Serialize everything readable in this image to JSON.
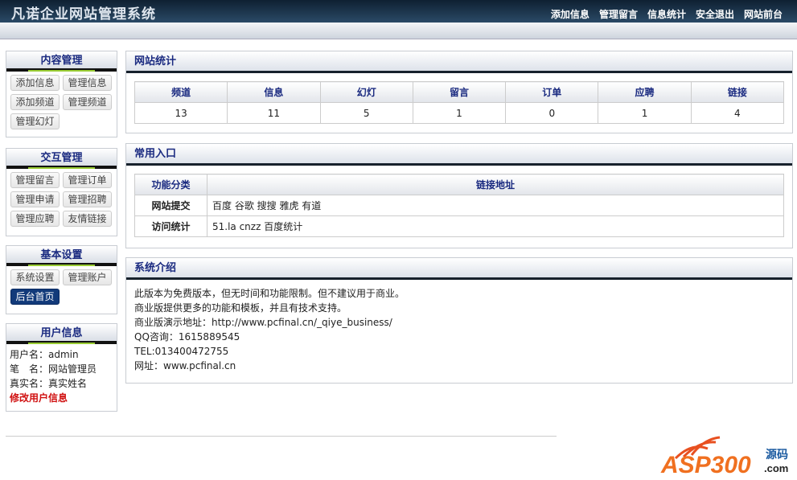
{
  "header": {
    "title": "凡诺企业网站管理系统",
    "nav": [
      "添加信息",
      "管理留言",
      "信息统计",
      "安全退出",
      "网站前台"
    ]
  },
  "sidebar": {
    "content": {
      "title": "内容管理",
      "buttons": [
        "添加信息",
        "管理信息",
        "添加频道",
        "管理频道",
        "管理幻灯"
      ]
    },
    "interact": {
      "title": "交互管理",
      "buttons": [
        "管理留言",
        "管理订单",
        "管理申请",
        "管理招聘",
        "管理应聘",
        "友情链接"
      ]
    },
    "basic": {
      "title": "基本设置",
      "buttons": [
        "系统设置",
        "管理账户",
        "后台首页"
      ]
    },
    "user": {
      "title": "用户信息",
      "lines": [
        "用户名：admin",
        "笔　名：网站管理员",
        "真实名：真实姓名"
      ],
      "edit": "修改用户信息"
    }
  },
  "stats": {
    "title": "网站统计",
    "headers": [
      "频道",
      "信息",
      "幻灯",
      "留言",
      "订单",
      "应聘",
      "链接"
    ],
    "values": [
      "13",
      "11",
      "5",
      "1",
      "0",
      "1",
      "4"
    ]
  },
  "entry": {
    "title": "常用入口",
    "headers": [
      "功能分类",
      "链接地址"
    ],
    "rows": [
      {
        "cat": "网站提交",
        "links": "百度 谷歌 搜搜 雅虎 有道"
      },
      {
        "cat": "访问统计",
        "links": "51.la cnzz 百度统计"
      }
    ]
  },
  "intro": {
    "title": "系统介绍",
    "lines": [
      "此版本为免费版本，但无时间和功能限制。但不建议用于商业。",
      "商业版提供更多的功能和模板，并且有技术支持。",
      "商业版演示地址：http://www.pcfinal.cn/_qiye_business/",
      "QQ咨询：1615889545",
      "TEL:013400472755",
      "网址：www.pcfinal.cn"
    ]
  },
  "watermark": {
    "text": "ASP300",
    "sub": "源码",
    "domain": ".com"
  }
}
